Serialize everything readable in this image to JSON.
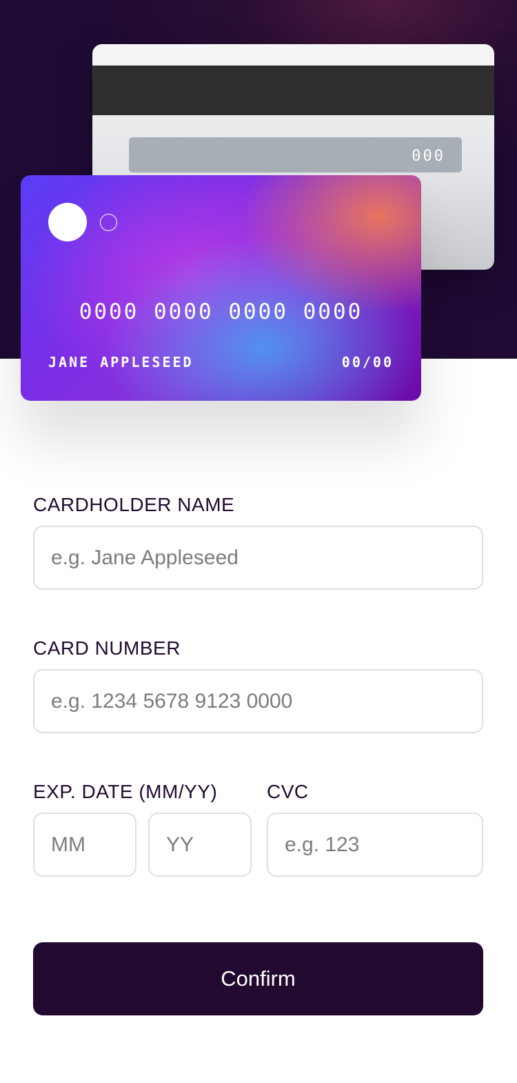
{
  "card_back": {
    "cvc": "000"
  },
  "card_front": {
    "number": "0000 0000 0000 0000",
    "holder": "JANE APPLESEED",
    "expiry": "00/00"
  },
  "form": {
    "name_label": "CARDHOLDER NAME",
    "name_placeholder": "e.g. Jane Appleseed",
    "number_label": "CARD NUMBER",
    "number_placeholder": "e.g. 1234 5678 9123 0000",
    "exp_label": "EXP. DATE (MM/YY)",
    "month_placeholder": "MM",
    "year_placeholder": "YY",
    "cvc_label": "CVC",
    "cvc_placeholder": "e.g. 123",
    "confirm_label": "Confirm"
  },
  "colors": {
    "hero_bg": "#1e0a33",
    "button_bg": "#21092f",
    "label_text": "#21092f",
    "input_border": "#dfdee0"
  }
}
